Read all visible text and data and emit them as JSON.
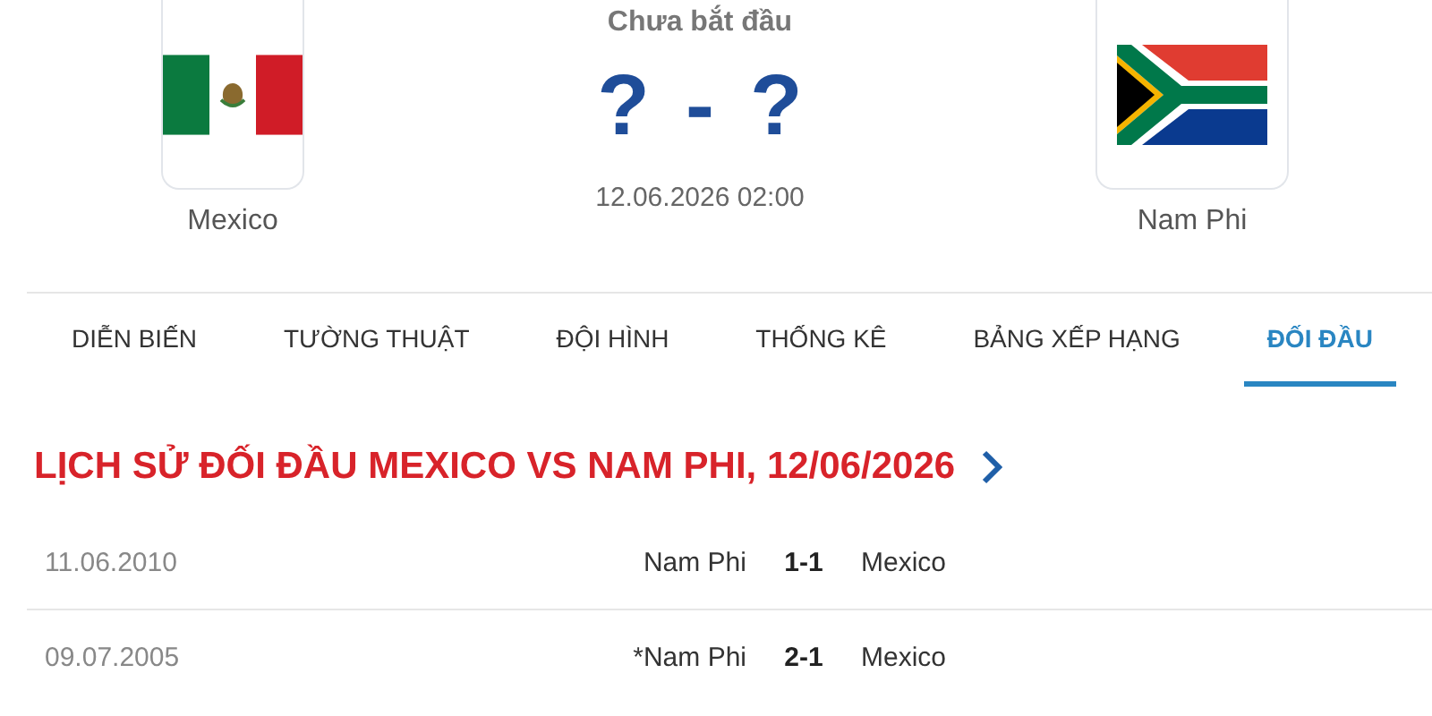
{
  "match": {
    "status": "Chưa bắt đầu",
    "home": {
      "name": "Mexico",
      "kind": "mexico"
    },
    "away": {
      "name": "Nam Phi",
      "kind": "south_africa"
    },
    "score_home": "?",
    "score_sep": "-",
    "score_away": "?",
    "datetime": "12.06.2026 02:00"
  },
  "tabs": [
    {
      "label": "DIỄN BIẾN",
      "selected": false
    },
    {
      "label": "TƯỜNG THUẬT",
      "selected": false
    },
    {
      "label": "ĐỘI HÌNH",
      "selected": false
    },
    {
      "label": "THỐNG KÊ",
      "selected": false
    },
    {
      "label": "BẢNG XẾP HẠNG",
      "selected": false
    },
    {
      "label": "ĐỐI ĐẦU",
      "selected": true
    }
  ],
  "section_title": "LỊCH SỬ ĐỐI ĐẦU MEXICO VS NAM PHI, 12/06/2026",
  "history": [
    {
      "date": "11.06.2010",
      "home": "Nam Phi",
      "score": "1-1",
      "away": "Mexico"
    },
    {
      "date": "09.07.2005",
      "home": "*Nam Phi",
      "score": "2-1",
      "away": "Mexico"
    }
  ]
}
